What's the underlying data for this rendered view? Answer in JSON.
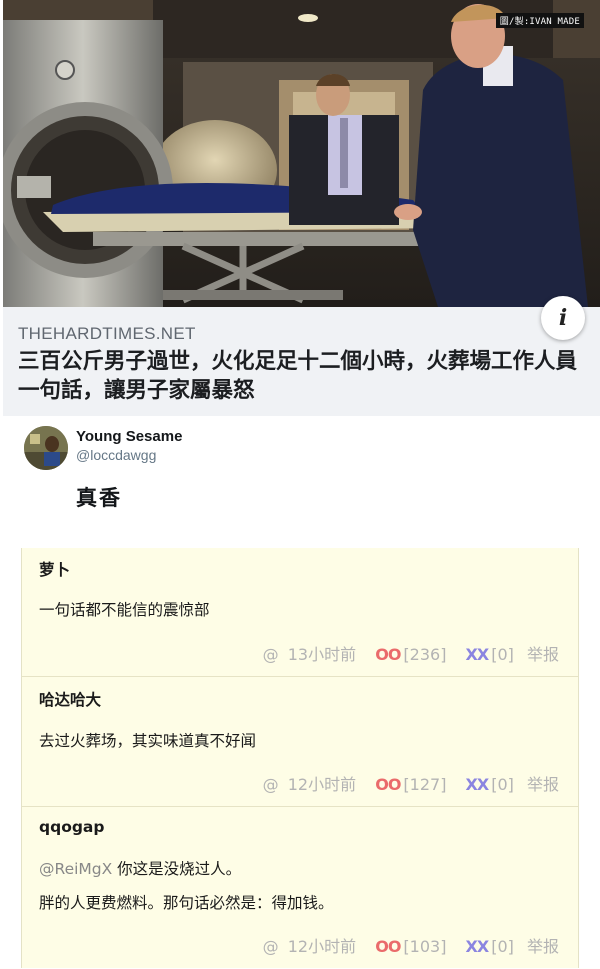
{
  "photo": {
    "credit": "圖/製:IVAN MADE"
  },
  "card": {
    "source": "THEHARDTIMES.NET",
    "headline": "三百公斤男子過世，火化足足十二個小時，火葬場工作人員一句話，讓男子家屬暴怒",
    "info_icon": "i"
  },
  "tweet": {
    "name": "Young Sesame",
    "handle": "@loccdawgg",
    "body": "真香"
  },
  "comments": [
    {
      "user": "萝卜",
      "mention": "",
      "lines": [
        "一句话都不能信的震惊部"
      ],
      "at": "@",
      "time": "13小时前",
      "oo_label": "OO",
      "oo_count": "[236]",
      "xx_label": "XX",
      "xx_count": "[0]",
      "report": "举报"
    },
    {
      "user": "哈达哈大",
      "mention": "",
      "lines": [
        "去过火葬场，其实味道真不好闻"
      ],
      "at": "@",
      "time": "12小时前",
      "oo_label": "OO",
      "oo_count": "[127]",
      "xx_label": "XX",
      "xx_count": "[0]",
      "report": "举报"
    },
    {
      "user": "qqogap",
      "mention": "@ReiMgX",
      "lines": [
        " 你这是没烧过人。",
        "胖的人更费燃料。那句话必然是：得加钱。"
      ],
      "at": "@",
      "time": "12小时前",
      "oo_label": "OO",
      "oo_count": "[103]",
      "xx_label": "XX",
      "xx_count": "[0]",
      "report": "举报"
    }
  ]
}
